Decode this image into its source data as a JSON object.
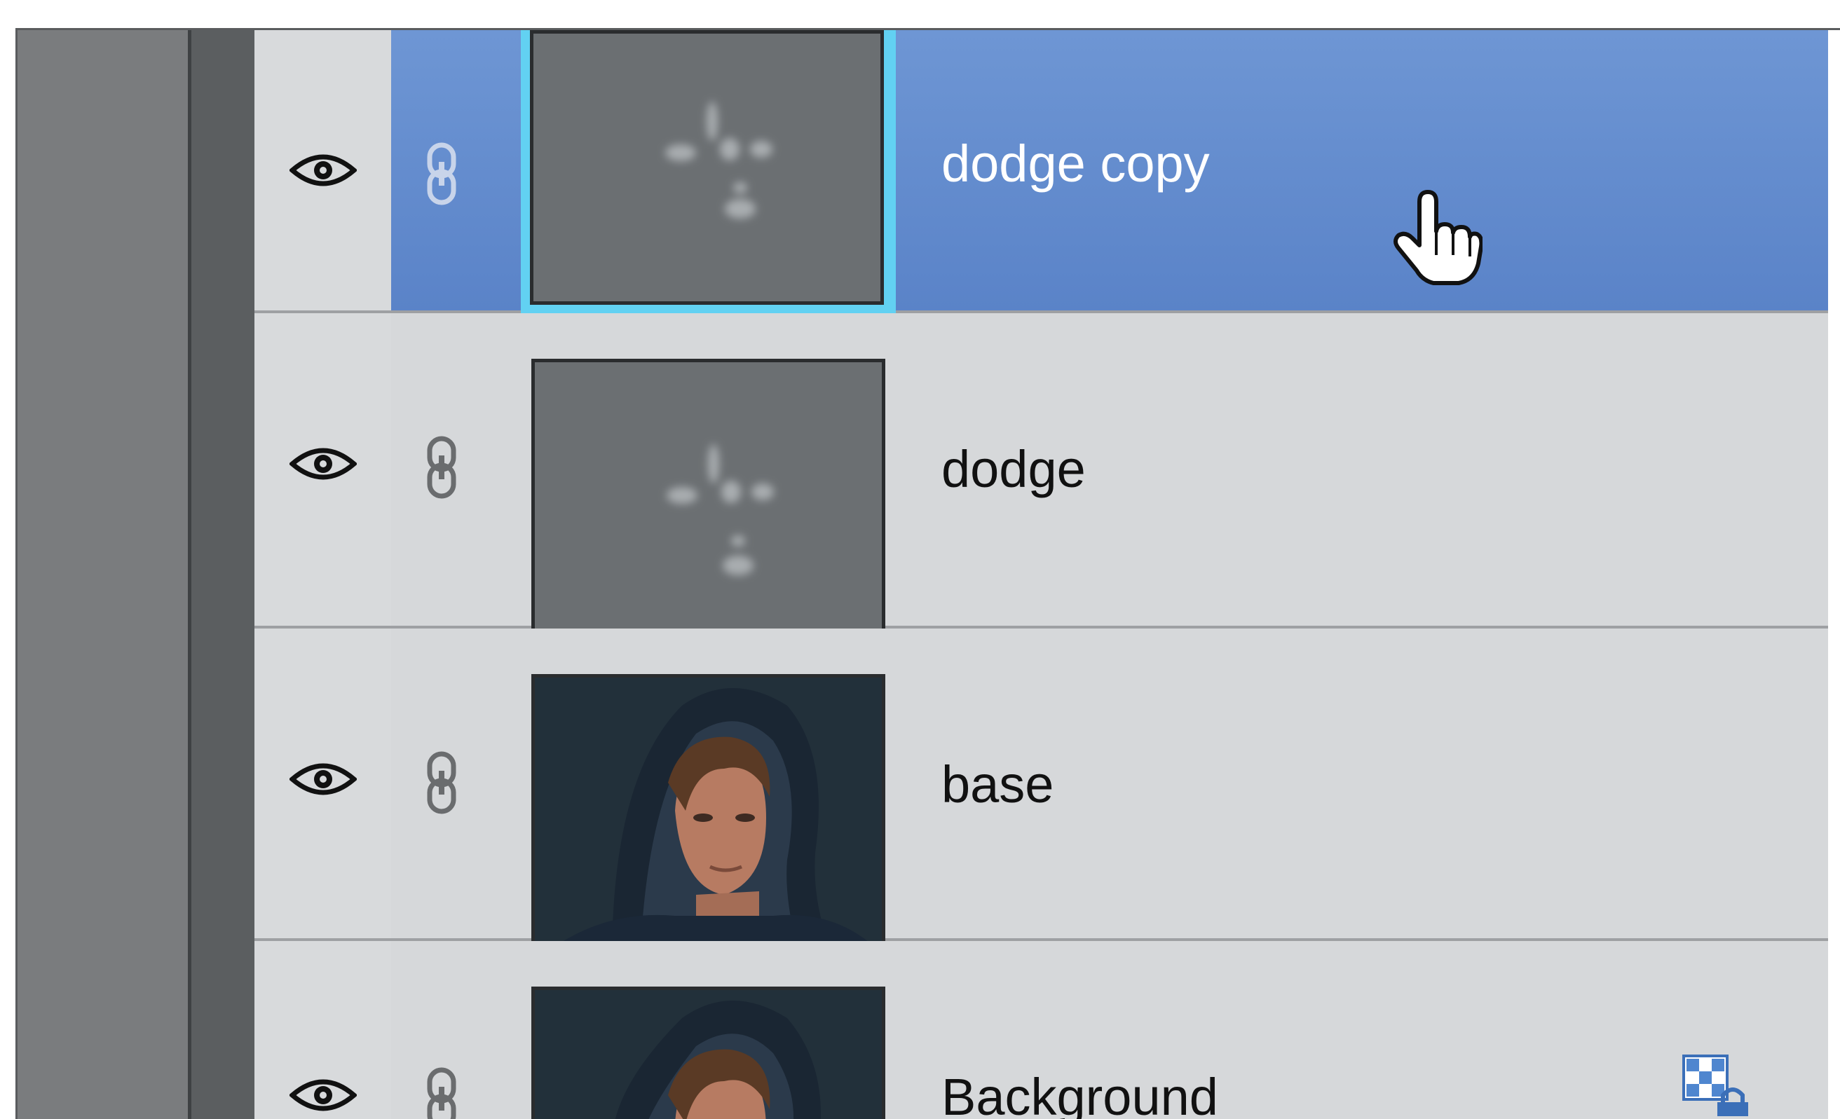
{
  "layers_panel": {
    "layers": [
      {
        "name": "dodge copy",
        "selected": true,
        "visible": true,
        "thumbnail": "dodge-mask-thumbnail"
      },
      {
        "name": "dodge",
        "selected": false,
        "visible": true,
        "thumbnail": "dodge-mask-thumbnail"
      },
      {
        "name": "base",
        "selected": false,
        "visible": true,
        "thumbnail": "hooded-man-portrait"
      },
      {
        "name": "Background",
        "selected": false,
        "visible": true,
        "thumbnail": "hooded-man-portrait",
        "locked": true
      }
    ],
    "selection_color": "#5f8ace",
    "highlight_color": "#62d1f2"
  },
  "icons": {
    "visibility": "eye-icon",
    "link": "chain-link-icon",
    "lock": "lock-icon",
    "cursor": "hand-pointer-cursor"
  }
}
